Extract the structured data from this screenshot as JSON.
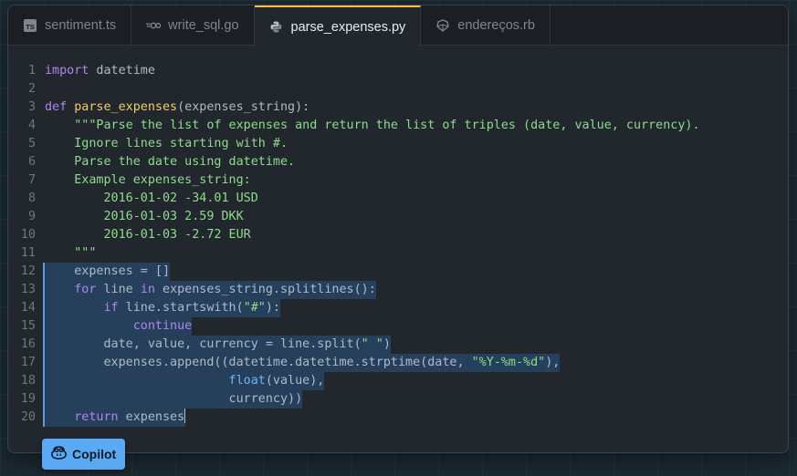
{
  "tabs": [
    {
      "label": "sentiment.ts",
      "icon": "typescript-icon",
      "active": false
    },
    {
      "label": "write_sql.go",
      "icon": "go-icon",
      "active": false
    },
    {
      "label": "parse_expenses.py",
      "icon": "python-icon",
      "active": true
    },
    {
      "label": "endereços.rb",
      "icon": "ruby-icon",
      "active": false
    }
  ],
  "editor": {
    "language": "python",
    "lines": [
      {
        "n": "1",
        "sel": false,
        "tokens": [
          [
            "kw",
            "import"
          ],
          [
            "txt",
            " datetime"
          ]
        ]
      },
      {
        "n": "2",
        "sel": false,
        "tokens": []
      },
      {
        "n": "3",
        "sel": false,
        "tokens": [
          [
            "kw",
            "def"
          ],
          [
            "txt",
            " "
          ],
          [
            "fn",
            "parse_expenses"
          ],
          [
            "txt",
            "(expenses_string):"
          ]
        ]
      },
      {
        "n": "4",
        "sel": false,
        "tokens": [
          [
            "str",
            "    \"\"\"Parse the list of expenses and return the list of triples (date, value, currency)."
          ]
        ]
      },
      {
        "n": "5",
        "sel": false,
        "tokens": [
          [
            "str",
            "    Ignore lines starting with #."
          ]
        ]
      },
      {
        "n": "6",
        "sel": false,
        "tokens": [
          [
            "str",
            "    Parse the date using datetime."
          ]
        ]
      },
      {
        "n": "7",
        "sel": false,
        "tokens": [
          [
            "str",
            "    Example expenses_string:"
          ]
        ]
      },
      {
        "n": "8",
        "sel": false,
        "tokens": [
          [
            "str",
            "        2016-01-02 -34.01 USD"
          ]
        ]
      },
      {
        "n": "9",
        "sel": false,
        "tokens": [
          [
            "str",
            "        2016-01-03 2.59 DKK"
          ]
        ]
      },
      {
        "n": "10",
        "sel": false,
        "tokens": [
          [
            "str",
            "        2016-01-03 -2.72 EUR"
          ]
        ]
      },
      {
        "n": "11",
        "sel": false,
        "tokens": [
          [
            "str",
            "    \"\"\""
          ]
        ]
      },
      {
        "n": "12",
        "sel": true,
        "tokens": [
          [
            "txt",
            "    expenses = []"
          ]
        ]
      },
      {
        "n": "13",
        "sel": true,
        "tokens": [
          [
            "txt",
            "    "
          ],
          [
            "kw",
            "for"
          ],
          [
            "txt",
            " line "
          ],
          [
            "kw",
            "in"
          ],
          [
            "txt",
            " expenses_string.splitlines():"
          ]
        ]
      },
      {
        "n": "14",
        "sel": true,
        "tokens": [
          [
            "txt",
            "        "
          ],
          [
            "kw",
            "if"
          ],
          [
            "txt",
            " line.startswith("
          ],
          [
            "str",
            "\"#\""
          ],
          [
            "txt",
            "):"
          ]
        ]
      },
      {
        "n": "15",
        "sel": true,
        "tokens": [
          [
            "txt",
            "            "
          ],
          [
            "kw",
            "continue"
          ]
        ]
      },
      {
        "n": "16",
        "sel": true,
        "tokens": [
          [
            "txt",
            "        date, value, currency = line.split("
          ],
          [
            "str",
            "\" \""
          ],
          [
            "txt",
            ")"
          ]
        ]
      },
      {
        "n": "17",
        "sel": true,
        "tokens": [
          [
            "txt",
            "        expenses.append((datetime.datetime.strptime(date, "
          ],
          [
            "str",
            "\"%Y-%m-%d\""
          ],
          [
            "txt",
            "),"
          ]
        ]
      },
      {
        "n": "18",
        "sel": true,
        "tokens": [
          [
            "txt",
            "                         "
          ],
          [
            "bi",
            "float"
          ],
          [
            "txt",
            "(value),"
          ]
        ]
      },
      {
        "n": "19",
        "sel": true,
        "tokens": [
          [
            "txt",
            "                         currency))"
          ]
        ]
      },
      {
        "n": "20",
        "sel": true,
        "caret": true,
        "tokens": [
          [
            "txt",
            "    "
          ],
          [
            "kw",
            "return"
          ],
          [
            "txt",
            " expenses"
          ]
        ]
      }
    ]
  },
  "copilot": {
    "label": "Copilot",
    "icon": "copilot-icon"
  },
  "colors": {
    "accent": "#f7b955",
    "selection": "#26405c",
    "copilot_bg": "#5aa9f5"
  }
}
